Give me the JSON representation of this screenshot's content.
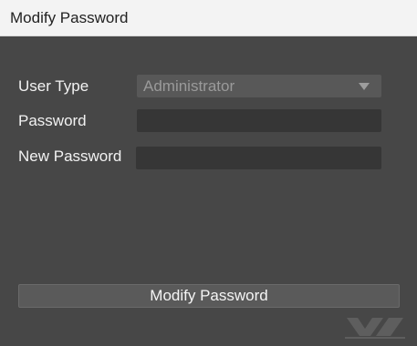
{
  "window": {
    "title": "Modify Password"
  },
  "form": {
    "user_type_label": "User Type",
    "user_type_value": "Administrator",
    "password_label": "Password",
    "password_value": "",
    "new_password_label": "New Password",
    "new_password_value": ""
  },
  "actions": {
    "submit_label": "Modify Password"
  },
  "icons": {
    "dropdown": "chevron-down-icon",
    "watermark": "brand-watermark-logo"
  },
  "colors": {
    "titlebar_bg": "#f3f3f3",
    "panel_bg": "#474747",
    "field_bg": "#363636",
    "select_bg": "#585858",
    "button_bg": "#5a5a5a",
    "text_light": "#f2f2f2",
    "text_disabled": "#9a9a9a"
  }
}
